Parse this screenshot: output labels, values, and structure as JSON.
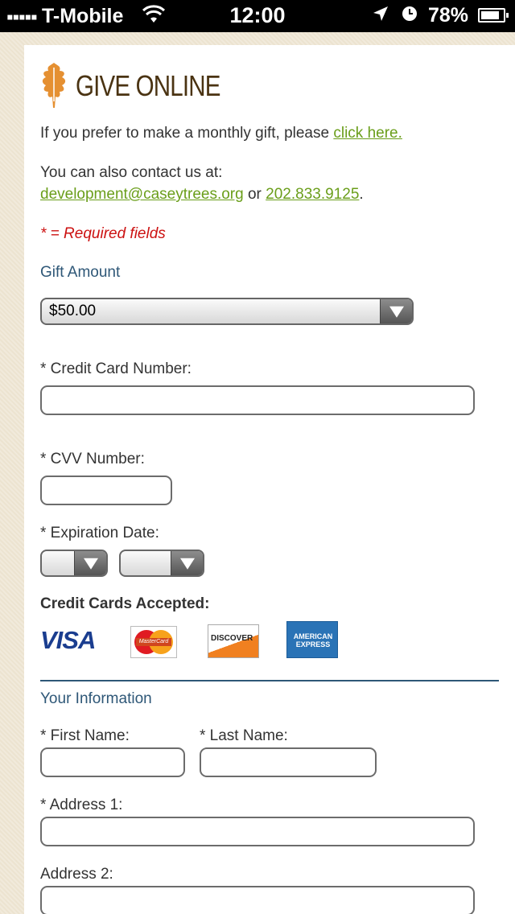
{
  "status_bar": {
    "signal": "▪▪▪▪▪",
    "carrier": "T-Mobile",
    "time": "12:00",
    "battery": "78%"
  },
  "page": {
    "title": "GIVE ONLINE",
    "monthly_text": "If you prefer to make a monthly gift, please ",
    "monthly_link": "click here.",
    "contact_text": "You can also contact us at:",
    "email_link": "development@caseytrees.org",
    "or_text": " or ",
    "phone_link": "202.833.9125",
    "period": ".",
    "required_note": "* = Required fields"
  },
  "gift_amount": {
    "label": "Gift Amount",
    "selected": "$50.00"
  },
  "payment": {
    "cc_number_label": "* Credit Card Number:",
    "cvv_label": "* CVV Number:",
    "expiration_label": "* Expiration Date:",
    "expiration_month": "",
    "expiration_year": "",
    "accepted_label": "Credit Cards Accepted:",
    "cards": {
      "visa": "VISA",
      "mastercard": "MasterCard",
      "discover": "DISCOVER",
      "amex": "AMERICAN EXPRESS"
    }
  },
  "your_info": {
    "label": "Your Information",
    "first_name_label": "* First Name:",
    "last_name_label": "* Last Name:",
    "address1_label": "* Address 1:",
    "address2_label": "Address 2:"
  },
  "colors": {
    "link": "#6a9e1a",
    "required": "#cc1111",
    "section": "#2e5777",
    "title": "#4a3312"
  }
}
